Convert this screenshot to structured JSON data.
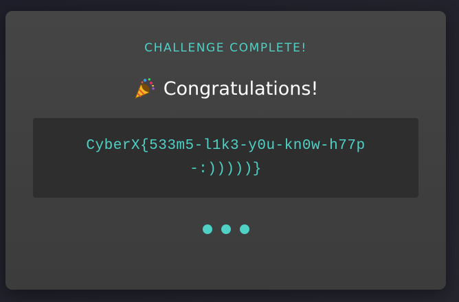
{
  "modal": {
    "subtitle": "CHALLENGE COMPLETE!",
    "title": "Congratulations!",
    "title_icon": "party-popper-icon",
    "flag": "CyberX{533m5-l1k3-y0u-kn0w-h77p-:)))))}",
    "loading_dots": 3
  },
  "colors": {
    "accent": "#4fd1c5",
    "card": "#424242",
    "flag_box": "#2e2e2e",
    "background": "#22222e"
  }
}
